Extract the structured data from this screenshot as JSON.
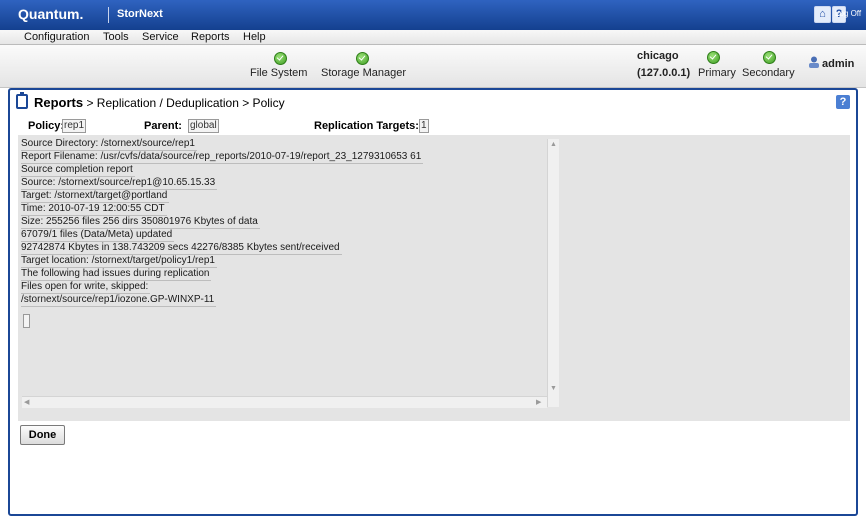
{
  "header": {
    "brand": "Quantum.",
    "product": "StorNext",
    "logoff_label": "Log Off"
  },
  "menu": [
    {
      "label": "Configuration"
    },
    {
      "label": "Tools"
    },
    {
      "label": "Service"
    },
    {
      "label": "Reports"
    },
    {
      "label": "Help"
    }
  ],
  "status": {
    "file_system": "File System",
    "storage_manager": "Storage Manager",
    "host": "chicago",
    "ip": "(127.0.0.1)",
    "primary": "Primary",
    "secondary": "Secondary",
    "user": "admin"
  },
  "breadcrumb": {
    "root": "Reports",
    "rest": " > Replication / Deduplication > Policy"
  },
  "fields": {
    "policy_label": "Policy:",
    "policy_value": "rep1",
    "parent_label": "Parent:",
    "parent_value": "global",
    "targets_label": "Replication Targets:",
    "targets_value": "1"
  },
  "report_lines": [
    "Source Directory: /stornext/source/rep1",
    "Report Filename: /usr/cvfs/data/source/rep_reports/2010-07-19/report_23_1279310653 61",
    "Source completion report",
    "Source: /stornext/source/rep1@10.65.15.33",
    "Target: /stornext/target@portland",
    "Time: 2010-07-19 12:00:55 CDT",
    "Size: 255256 files 256 dirs 350801976 Kbytes of data",
    "67079/1 files (Data/Meta) updated",
    "92742874 Kbytes in 138.743209 secs 42276/8385 Kbytes sent/received",
    "Target location: /stornext/target/policy1/rep1",
    "The following had issues during replication",
    "Files open for write, skipped:",
    "/stornext/source/rep1/iozone.GP-WINXP-11"
  ],
  "done_label": "Done"
}
